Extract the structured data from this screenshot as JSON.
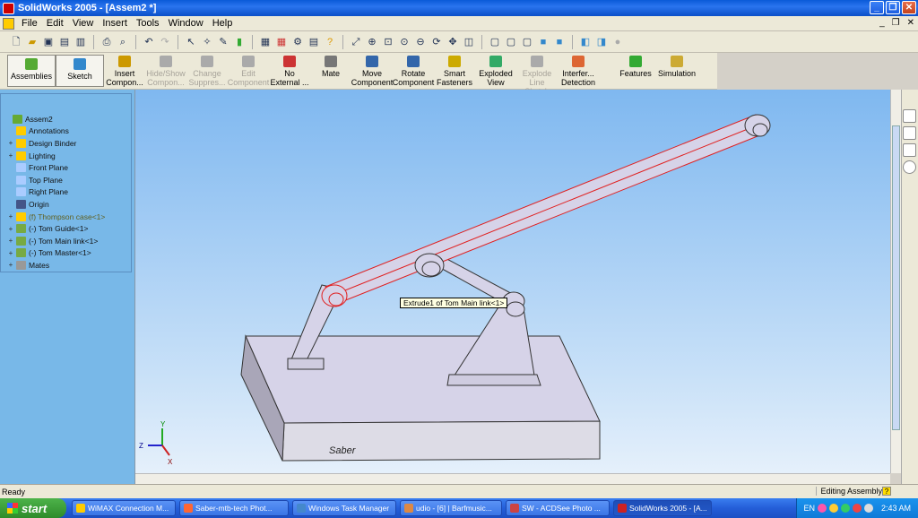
{
  "window": {
    "app_name": "SolidWorks 2005",
    "title": "SolidWorks 2005 - [Assem2 *]"
  },
  "menu": [
    "File",
    "Edit",
    "View",
    "Insert",
    "Tools",
    "Window",
    "Help"
  ],
  "command_manager": [
    {
      "label": "Assemblies",
      "enabled": true,
      "icon": "assemblies-icon"
    },
    {
      "label": "Sketch",
      "enabled": true,
      "icon": "sketch-icon"
    },
    {
      "label": "Insert Compon...",
      "enabled": true,
      "icon": "insert-component-icon"
    },
    {
      "label": "Hide/Show Compon...",
      "enabled": false,
      "icon": "hide-show-icon"
    },
    {
      "label": "Change Suppres...",
      "enabled": false,
      "icon": "change-suppression-icon"
    },
    {
      "label": "Edit Component",
      "enabled": false,
      "icon": "edit-component-icon"
    },
    {
      "label": "No External ...",
      "enabled": true,
      "icon": "no-external-icon"
    },
    {
      "label": "Mate",
      "enabled": true,
      "icon": "mate-icon"
    },
    {
      "label": "Move Component",
      "enabled": true,
      "icon": "move-component-icon"
    },
    {
      "label": "Rotate Component",
      "enabled": true,
      "icon": "rotate-component-icon"
    },
    {
      "label": "Smart Fasteners",
      "enabled": true,
      "icon": "smart-fasteners-icon"
    },
    {
      "label": "Exploded View",
      "enabled": true,
      "icon": "exploded-view-icon"
    },
    {
      "label": "Explode Line Sketch",
      "enabled": false,
      "icon": "explode-line-icon"
    },
    {
      "label": "Interfer... Detection",
      "enabled": true,
      "icon": "interference-icon"
    },
    {
      "label": "Features",
      "enabled": true,
      "icon": "features-icon"
    },
    {
      "label": "Simulation",
      "enabled": true,
      "icon": "simulation-icon"
    }
  ],
  "feature_tree": [
    {
      "label": "Assem2",
      "expander": "",
      "icon": "assembly-icon",
      "warn": false
    },
    {
      "label": "Annotations",
      "expander": "",
      "icon": "annotations-icon",
      "warn": false
    },
    {
      "label": "Design Binder",
      "expander": "+",
      "icon": "design-binder-icon",
      "warn": false
    },
    {
      "label": "Lighting",
      "expander": "+",
      "icon": "lighting-icon",
      "warn": false
    },
    {
      "label": "Front Plane",
      "expander": "",
      "icon": "plane-icon",
      "warn": false
    },
    {
      "label": "Top Plane",
      "expander": "",
      "icon": "plane-icon",
      "warn": false
    },
    {
      "label": "Right Plane",
      "expander": "",
      "icon": "plane-icon",
      "warn": false
    },
    {
      "label": "Origin",
      "expander": "",
      "icon": "origin-icon",
      "warn": false
    },
    {
      "label": "(f) Thompson case<1>",
      "expander": "+",
      "icon": "part-warning-icon",
      "warn": true
    },
    {
      "label": "(-) Tom Guide<1>",
      "expander": "+",
      "icon": "part-icon",
      "warn": false
    },
    {
      "label": "(-) Tom Main link<1>",
      "expander": "+",
      "icon": "part-icon",
      "warn": false
    },
    {
      "label": "(-) Tom Master<1>",
      "expander": "+",
      "icon": "part-icon",
      "warn": false
    },
    {
      "label": "Mates",
      "expander": "+",
      "icon": "mates-icon",
      "warn": false
    }
  ],
  "viewport": {
    "tooltip": "Extrude1 of Tom Main link<1>",
    "base_text": "Saber",
    "triad": {
      "x": "X",
      "y": "Y",
      "z": "Z"
    }
  },
  "status": {
    "left": "Ready",
    "right": "Editing Assembly"
  },
  "taskbar": {
    "start_label": "start",
    "tasks": [
      {
        "label": "WiMAX Connection M...",
        "active": false
      },
      {
        "label": "Saber-mtb-tech Phot...",
        "active": false
      },
      {
        "label": "Windows Task Manager",
        "active": false
      },
      {
        "label": "udio - [6] | Barfmusic...",
        "active": false
      },
      {
        "label": "SW - ACDSee Photo ...",
        "active": false
      },
      {
        "label": "SolidWorks 2005 - [A...",
        "active": true
      }
    ],
    "lang": "EN",
    "clock": "2:43 AM"
  },
  "colors": {
    "accent": "#0a5ad8",
    "part_fill": "#d6d3e8",
    "highlight": "#e02020"
  }
}
